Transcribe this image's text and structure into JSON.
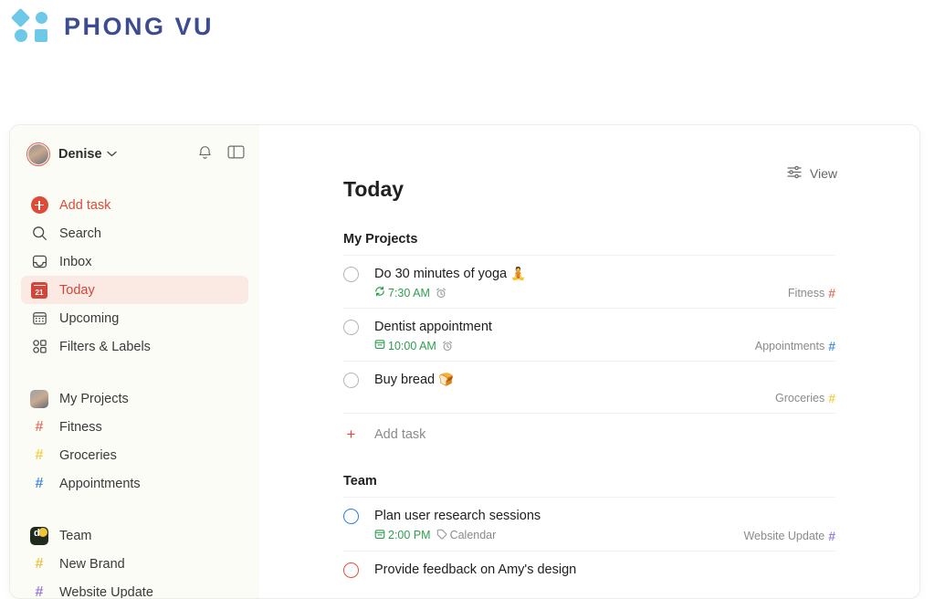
{
  "brand": {
    "name": "PHONG VU",
    "logo_icon": "four-shapes-logo",
    "color": "#3c4c8f",
    "shape_color": "#6ec8e8"
  },
  "sidebar": {
    "user": {
      "name": "Denise",
      "avatar_icon": "user-avatar",
      "chevron_icon": "chevron-down-icon"
    },
    "actions": [
      {
        "name": "notifications",
        "icon": "bell-icon"
      },
      {
        "name": "toggle-sidebar",
        "icon": "sidebar-panel-icon"
      }
    ],
    "nav": [
      {
        "label": "Add task",
        "icon": "plus-circle-icon",
        "type": "addtask"
      },
      {
        "label": "Search",
        "icon": "search-icon",
        "type": "nav"
      },
      {
        "label": "Inbox",
        "icon": "inbox-icon",
        "type": "nav"
      },
      {
        "label": "Today",
        "icon": "calendar-today-icon",
        "type": "nav",
        "active": true,
        "badge": "21"
      },
      {
        "label": "Upcoming",
        "icon": "calendar-grid-icon",
        "type": "nav"
      },
      {
        "label": "Filters & Labels",
        "icon": "filters-labels-icon",
        "type": "nav"
      }
    ],
    "projects_group": {
      "header": {
        "label": "My Projects",
        "icon": "project-avatar-icon"
      },
      "items": [
        {
          "label": "Fitness",
          "icon": "hash-icon",
          "color": "#e8766b"
        },
        {
          "label": "Groceries",
          "icon": "hash-icon",
          "color": "#f5cf47"
        },
        {
          "label": "Appointments",
          "icon": "hash-icon",
          "color": "#4a90e2"
        }
      ]
    },
    "team_group": {
      "header": {
        "label": "Team",
        "icon": "team-avatar-icon"
      },
      "items": [
        {
          "label": "New Brand",
          "icon": "hash-icon",
          "color": "#eec44f"
        },
        {
          "label": "Website Update",
          "icon": "hash-icon",
          "color": "#9b7fe0"
        }
      ]
    }
  },
  "main": {
    "view_button": {
      "label": "View",
      "icon": "sliders-icon"
    },
    "page_title": "Today",
    "sections": [
      {
        "title": "My Projects",
        "tasks": [
          {
            "title": "Do 30 minutes of yoga",
            "emoji": "🧘",
            "checkbox_color": "gray",
            "time": "7:30 AM",
            "time_icon": "recurring-icon",
            "extra_icon": "alarm-clock-icon",
            "label": "",
            "label_icon": "",
            "project": "Fitness",
            "project_hash_color": "#e8766b"
          },
          {
            "title": "Dentist appointment",
            "emoji": "",
            "checkbox_color": "gray",
            "time": "10:00 AM",
            "time_icon": "calendar-small-icon",
            "extra_icon": "alarm-clock-icon",
            "label": "",
            "label_icon": "",
            "project": "Appointments",
            "project_hash_color": "#4a90e2"
          },
          {
            "title": "Buy bread",
            "emoji": "🍞",
            "checkbox_color": "gray",
            "time": "",
            "time_icon": "",
            "extra_icon": "",
            "label": "",
            "label_icon": "",
            "project": "Groceries",
            "project_hash_color": "#f5cf47"
          }
        ],
        "add_task_label": "Add task"
      },
      {
        "title": "Team",
        "tasks": [
          {
            "title": "Plan user research sessions",
            "emoji": "",
            "checkbox_color": "blue",
            "time": "2:00 PM",
            "time_icon": "calendar-small-icon",
            "extra_icon": "",
            "label": "Calendar",
            "label_icon": "tag-icon",
            "project": "Website Update",
            "project_hash_color": "#9b7fe0"
          },
          {
            "title": "Provide feedback on Amy's design",
            "emoji": "",
            "checkbox_color": "red",
            "time": "",
            "time_icon": "",
            "extra_icon": "",
            "label": "",
            "label_icon": "",
            "project": "",
            "project_hash_color": "#9b7fe0"
          }
        ],
        "add_task_label": ""
      }
    ]
  }
}
